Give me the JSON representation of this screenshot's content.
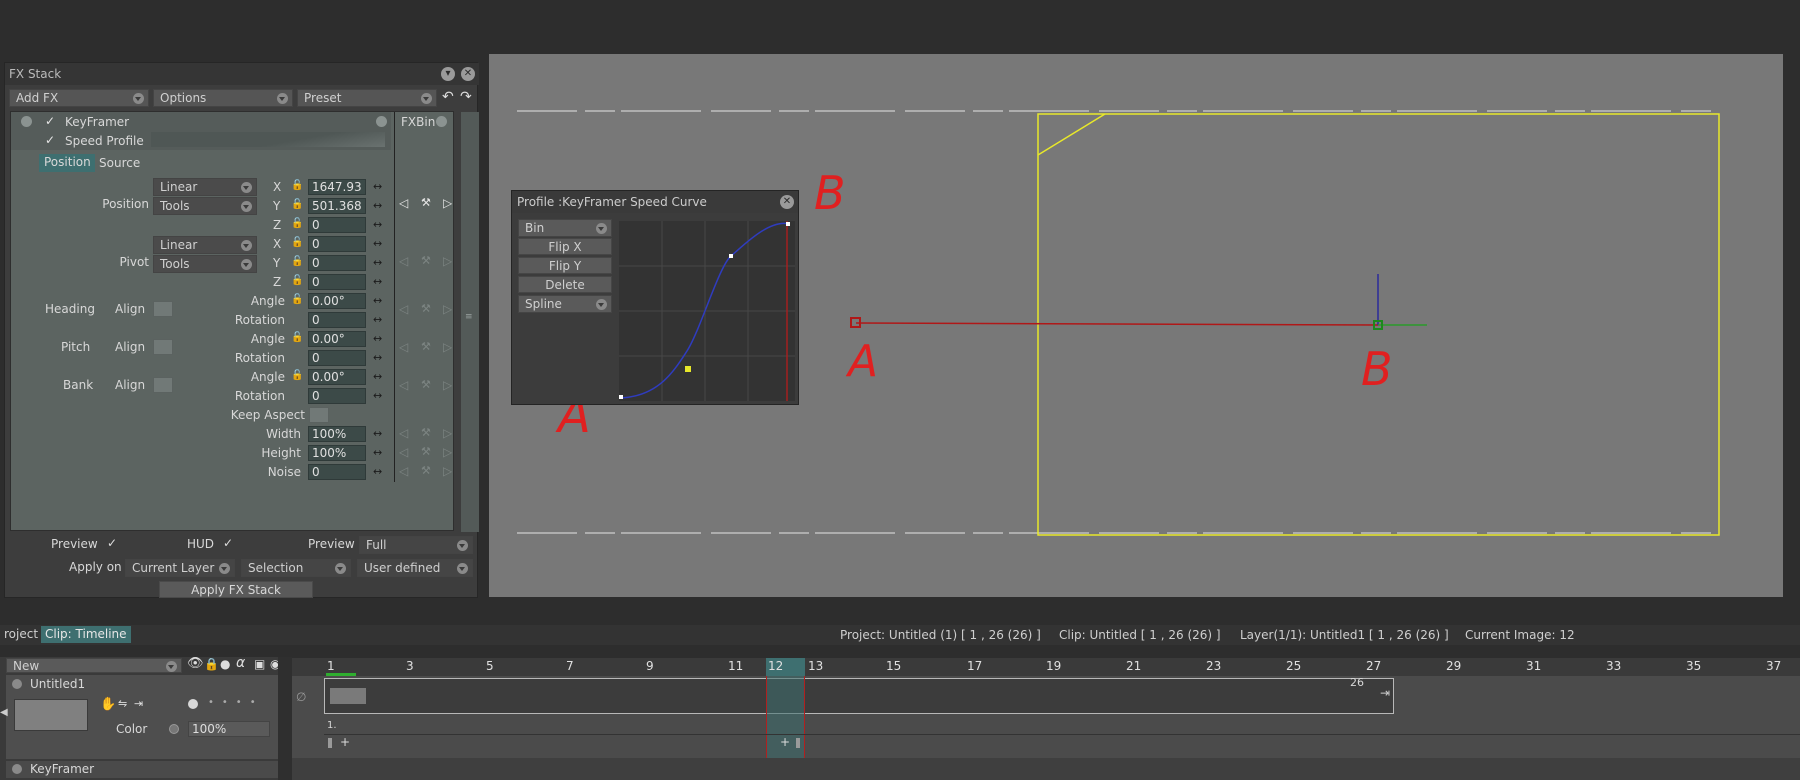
{
  "fx_stack": {
    "title": "FX Stack",
    "toolbar": {
      "add_fx": "Add FX",
      "options": "Options",
      "preset": "Preset"
    },
    "layer_name": "KeyFramer",
    "speed_profile": "Speed Profile",
    "fxbin": "FXBin",
    "tabs": [
      "Position",
      "Source"
    ],
    "position": {
      "label": "Position",
      "mode": "Linear",
      "tools": "Tools",
      "x": "1647.93",
      "y": "501.368",
      "z": "0"
    },
    "pivot": {
      "label": "Pivot",
      "mode": "Linear",
      "tools": "Tools",
      "x": "0",
      "y": "0",
      "z": "0"
    },
    "axis_labels": {
      "x": "X",
      "y": "Y",
      "z": "Z"
    },
    "heading": {
      "label": "Heading",
      "align": "Align",
      "angle_label": "Angle",
      "angle": "0.00°",
      "rotation_label": "Rotation",
      "rotation": "0"
    },
    "pitch": {
      "label": "Pitch",
      "align": "Align",
      "angle_label": "Angle",
      "angle": "0.00°",
      "rotation_label": "Rotation",
      "rotation": "0"
    },
    "bank": {
      "label": "Bank",
      "align": "Align",
      "angle_label": "Angle",
      "angle": "0.00°",
      "rotation_label": "Rotation",
      "rotation": "0"
    },
    "keep_aspect": "Keep Aspect",
    "width_label": "Width",
    "width": "100%",
    "height_label": "Height",
    "height": "100%",
    "noise_label": "Noise",
    "noise": "0",
    "bottom": {
      "preview_label": "Preview",
      "hud_label": "HUD",
      "preview2_label": "Preview",
      "preview_mode": "Full",
      "apply_on_label": "Apply on",
      "apply_on": "Current Layer",
      "selection": "Selection",
      "user_defined": "User defined",
      "apply_button": "Apply FX Stack"
    }
  },
  "profile": {
    "title": "Profile :KeyFramer Speed Curve",
    "bin": "Bin",
    "flip_x": "Flip X",
    "flip_y": "Flip Y",
    "delete": "Delete",
    "spline": "Spline"
  },
  "annotations": {
    "a": "A",
    "b": "B"
  },
  "timeline": {
    "tabs": [
      "roject",
      "Clip: Timeline"
    ],
    "info": {
      "project": "Project: Untitled (1) [ 1 , 26  (26) ]",
      "clip": "Clip: Untitled [ 1 , 26  (26) ]",
      "layer": "Layer(1/1): Untitled1 [ 1 , 26  (26) ]",
      "current": "Current Image: 12"
    },
    "new_label": "New",
    "layer_name": "Untitled1",
    "color_label": "Color",
    "opacity": "100%",
    "fx_name": "KeyFramer",
    "ruler": [
      "1",
      "3",
      "5",
      "7",
      "9",
      "11",
      "12",
      "13",
      "15",
      "17",
      "19",
      "21",
      "23",
      "25",
      "27",
      "29",
      "31",
      "33",
      "35",
      "37"
    ],
    "clip_end": "26",
    "key_label": "1.",
    "current_frame": 12
  },
  "colors": {
    "accent_yellow": "#e8e82a",
    "annotation_red": "#e02020",
    "curve_blue": "#2f3cbf",
    "teal": "#3e6f70"
  }
}
